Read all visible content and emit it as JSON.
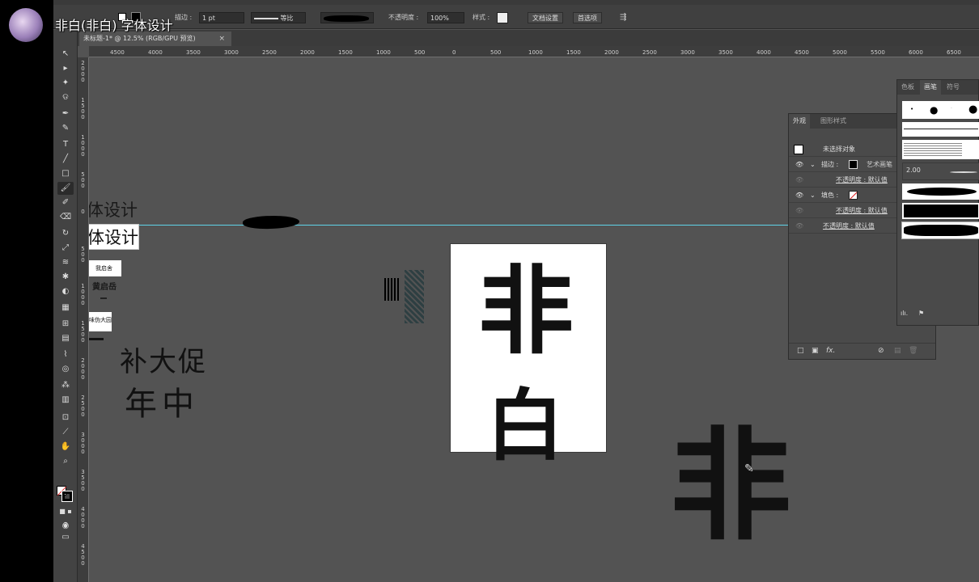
{
  "video_title": "非白(非白) 字体设计",
  "control_bar": {
    "stroke_label": "描边 :",
    "stroke_weight": "1 pt",
    "profile_label": "等比",
    "opacity_label": "不透明度 :",
    "opacity_value": "100%",
    "style_label": "样式 :",
    "doc_setup_button": "文档设置",
    "preferences_button": "首选项"
  },
  "document_tab": {
    "title": "未标题-1* @ 12.5% (RGB/GPU 预览)",
    "close": "×"
  },
  "ruler": {
    "h_ticks": [
      "4500",
      "4000",
      "3500",
      "3000",
      "2500",
      "2000",
      "1500",
      "1000",
      "500",
      "0",
      "500",
      "1000",
      "1500",
      "2000",
      "2500",
      "3000",
      "3500",
      "4000",
      "4500",
      "5000",
      "5500",
      "6000",
      "6500"
    ],
    "v_ticks": [
      "2000",
      "1500",
      "1000",
      "500",
      "0",
      "500",
      "1000",
      "1500",
      "2000",
      "2500",
      "3000",
      "3500",
      "4000",
      "4500"
    ]
  },
  "canvas": {
    "text_line1": "体设计",
    "text_line2": "体设计",
    "stamp1": "我启舍",
    "stamp2": "黄启岳",
    "stamp3": "味伪大园",
    "handwritten1": "补大促",
    "handwritten2": "年中",
    "artboard_line1": "非",
    "artboard_line2": "白",
    "big_glyph": "非"
  },
  "appearance_panel": {
    "tabs": [
      "外观",
      "图形样式"
    ],
    "header": "未选择对象",
    "rows": [
      {
        "label": "描边 :",
        "value": "艺术画笔"
      },
      {
        "label": "不透明度 : 默认值"
      },
      {
        "label": "填色 :"
      },
      {
        "label": "不透明度 : 默认值"
      },
      {
        "label": "不透明度 : 默认值"
      }
    ],
    "fx_label": "fx."
  },
  "brush_panel": {
    "tabs": [
      "色板",
      "画笔",
      "符号"
    ],
    "size_label": "2.00"
  },
  "colors": {
    "app_bg": "#535353",
    "guide": "#5fd3e8"
  }
}
